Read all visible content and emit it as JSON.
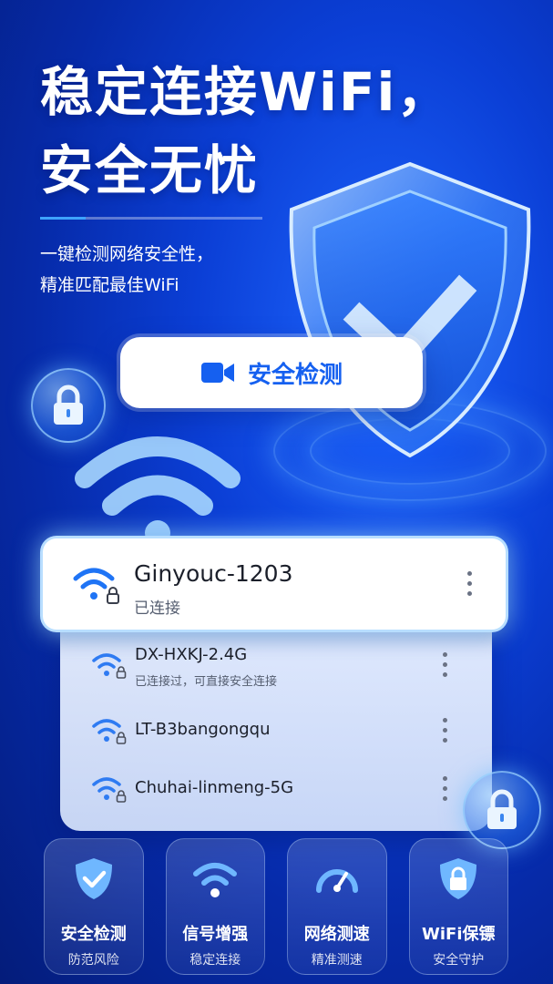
{
  "hero": {
    "line1": "稳定连接WiFi，",
    "line2": "安全无忧",
    "subtitle1": "一键检测网络安全性，",
    "subtitle2": "精准匹配最佳WiFi"
  },
  "check_button": {
    "label": "安全检测",
    "icon": "video-camera-icon"
  },
  "current_network": {
    "ssid": "Ginyouc-1203",
    "status": "已连接"
  },
  "networks": [
    {
      "ssid": "DX-HXKJ-2.4G",
      "note": "已连接过，可直接安全连接"
    },
    {
      "ssid": "LT-B3bangongqu",
      "note": ""
    },
    {
      "ssid": "Chuhai-linmeng-5G",
      "note": ""
    }
  ],
  "features": [
    {
      "title": "安全检测",
      "subtitle": "防范风险",
      "icon": "shield-check-icon"
    },
    {
      "title": "信号增强",
      "subtitle": "稳定连接",
      "icon": "wifi-signal-icon"
    },
    {
      "title": "网络测速",
      "subtitle": "精准测速",
      "icon": "speedometer-icon"
    },
    {
      "title": "WiFi保镖",
      "subtitle": "安全守护",
      "icon": "shield-lock-icon"
    }
  ],
  "colors": {
    "accent": "#1560f0",
    "background": "#0b3fd6"
  }
}
